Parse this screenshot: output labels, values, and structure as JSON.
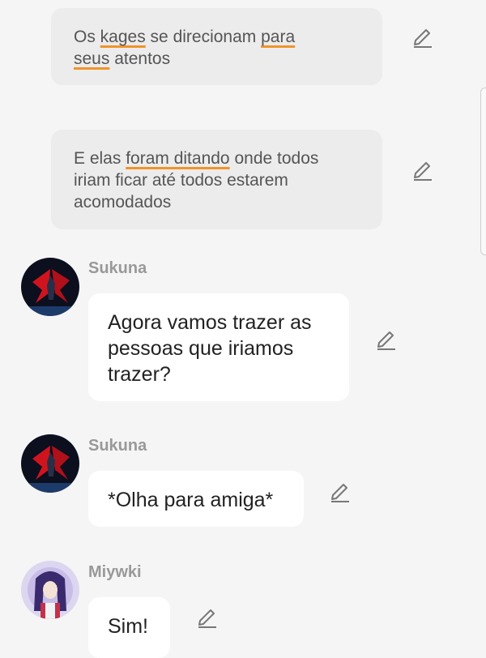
{
  "system_messages": [
    {
      "segments": [
        {
          "text": "Os ",
          "underline": false
        },
        {
          "text": "kages",
          "underline": true
        },
        {
          "text": " se direcionam ",
          "underline": false
        },
        {
          "text": "para",
          "underline": true
        },
        {
          "text": "\n",
          "underline": false
        },
        {
          "text": "seus",
          "underline": true
        },
        {
          "text": " atentos",
          "underline": false
        }
      ]
    },
    {
      "segments": [
        {
          "text": "E elas ",
          "underline": false
        },
        {
          "text": "foram ditando",
          "underline": true
        },
        {
          "text": " onde todos\niriam ficar até todos estarem\nacomodados",
          "underline": false
        }
      ]
    }
  ],
  "messages": [
    {
      "author": "Sukuna",
      "text": "Agora vamos trazer as\npessoas que iriamos\ntrazer?",
      "avatar": "dark-winged-character-avatar"
    },
    {
      "author": "Sukuna",
      "text": "*Olha para amiga*",
      "avatar": "dark-winged-character-avatar"
    },
    {
      "author": "Miywki",
      "text": "Sim!",
      "avatar": "purple-haired-character-avatar"
    }
  ],
  "icons": {
    "edit": "pencil-edit-icon"
  },
  "colors": {
    "background": "#f5f5f5",
    "system_bubble": "#ececec",
    "message_bubble": "#ffffff",
    "underline": "#f0942a",
    "author_name": "#999999"
  }
}
